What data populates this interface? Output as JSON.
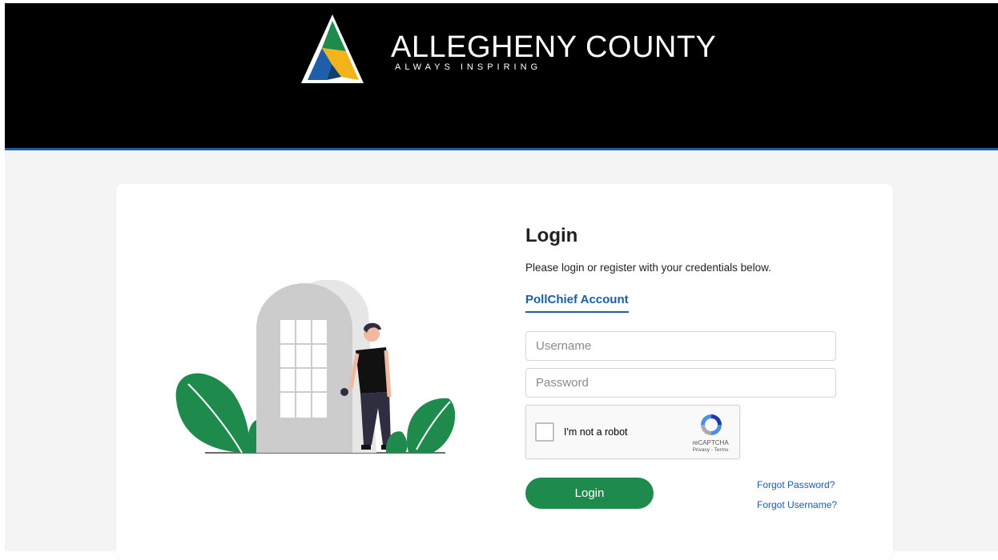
{
  "header": {
    "brand_name": "ALLEGHENY COUNTY",
    "tagline": "ALWAYS INSPIRING",
    "logo_icon": "allegheny-county-logo",
    "background_color": "#000000",
    "accent_color": "#1f5fa9"
  },
  "login": {
    "title": "Login",
    "subtitle": "Please login or register with your credentials below.",
    "tab_label": "PollChief Account",
    "username_placeholder": "Username",
    "password_placeholder": "Password",
    "button_label": "Login",
    "button_color": "#1e8b4d",
    "forgot_password": "Forgot Password?",
    "forgot_username": "Forgot Username?"
  },
  "captcha": {
    "label": "I'm not a robot",
    "brand": "reCAPTCHA",
    "links": "Privacy - Terms",
    "icon": "recaptcha-icon"
  }
}
